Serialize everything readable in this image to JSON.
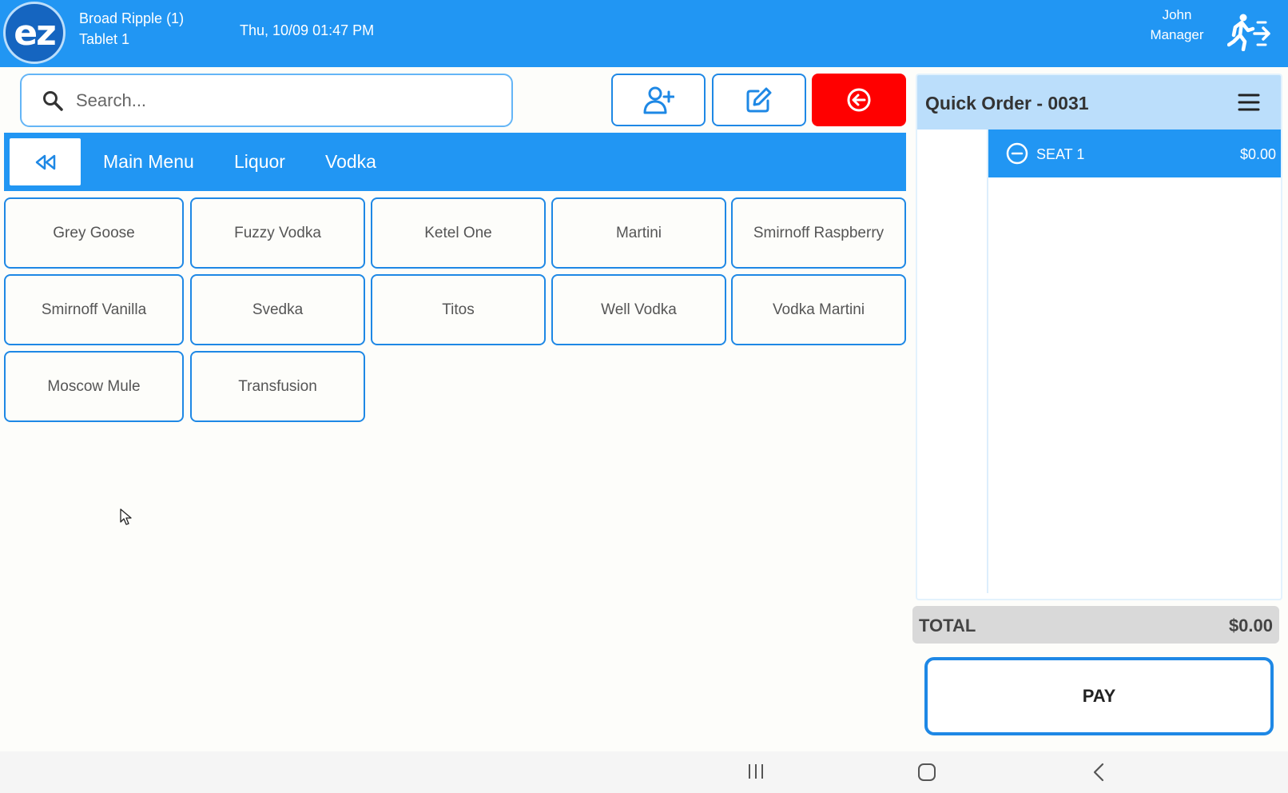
{
  "header": {
    "logo_text": "ez",
    "store_name": "Broad Ripple (1)",
    "device": "Tablet 1",
    "datetime": "Thu, 10/09 01:47 PM",
    "user_name": "John",
    "user_role": "Manager",
    "logout_icon": "exit-running-icon"
  },
  "search": {
    "placeholder": "Search..."
  },
  "actions": [
    {
      "name": "add-customer-button",
      "icon": "person-add-icon"
    },
    {
      "name": "edit-button",
      "icon": "edit-icon"
    },
    {
      "name": "exit-order-button",
      "icon": "arrow-left-circle-icon",
      "color": "#ff0000"
    }
  ],
  "breadcrumb": {
    "back_icon": "rewind-icon",
    "items": [
      "Main Menu",
      "Liquor",
      "Vodka"
    ]
  },
  "menu_items": [
    "Grey Goose",
    "Fuzzy Vodka",
    "Ketel One",
    "Martini",
    "Smirnoff Raspberry",
    "Smirnoff Vanilla",
    "Svedka",
    "Titos",
    "Well Vodka",
    "Vodka Martini",
    "Moscow Mule",
    "Transfusion"
  ],
  "order": {
    "title": "Quick Order - 0031",
    "seat_label": "SEAT 1",
    "seat_price": "$0.00",
    "total_label": "TOTAL",
    "total_value": "$0.00",
    "pay_label": "PAY"
  },
  "colors": {
    "accent": "#2196f3",
    "danger": "#ff0000",
    "panel_header": "#bbdefb"
  }
}
